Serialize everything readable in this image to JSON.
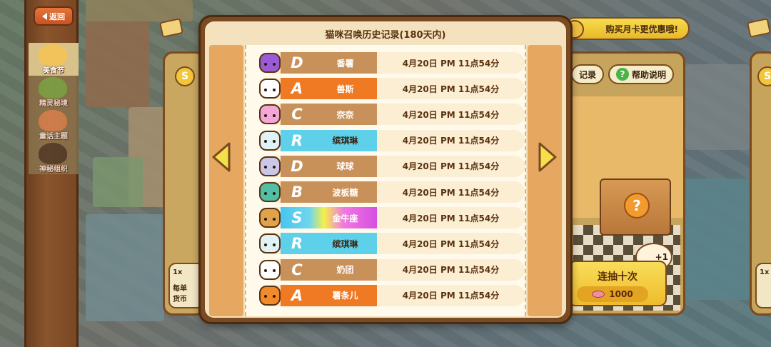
{
  "sidebar": {
    "back_label": "返回",
    "items": [
      {
        "label": "美食节",
        "color": "#f2c35a",
        "active": true
      },
      {
        "label": "精灵秘境",
        "color": "#7ab34c"
      },
      {
        "label": "童话主题",
        "color": "#e58a55"
      },
      {
        "label": "神秘组织",
        "color": "#4a3a2a"
      }
    ]
  },
  "background": {
    "monthly_card": "购买月卡更优惠哦!",
    "record_btn": "记录",
    "help_btn": "帮助说明",
    "help_icon": "?",
    "box_icon": "?",
    "bowl_count": "+1",
    "ten_draw": {
      "label": "连抽十次",
      "cost": "1000"
    },
    "one_draw": {
      "count": "1x",
      "line1": "每单",
      "line2": "货币"
    },
    "one_draw_right": {
      "count": "1x"
    },
    "s_badge": "S"
  },
  "modal": {
    "title": "猫咪召唤历史记录(180天内)",
    "records": [
      {
        "rank": "D",
        "name": "番薯",
        "time": "4月20日 PM 11点54分",
        "cat": "#9a5bd6",
        "style": "plain"
      },
      {
        "rank": "A",
        "name": "兽斯",
        "time": "4月20日 PM 11点54分",
        "cat": "#ffffff",
        "style": "A"
      },
      {
        "rank": "C",
        "name": "奈奈",
        "time": "4月20日 PM 11点54分",
        "cat": "#f3a7d8",
        "style": "plain"
      },
      {
        "rank": "R",
        "name": "缤琪琳",
        "time": "4月20日 PM 11点54分",
        "cat": "#dff2f7",
        "style": "R"
      },
      {
        "rank": "D",
        "name": "球球",
        "time": "4月20日 PM 11点54分",
        "cat": "#cbc7e8",
        "style": "plain"
      },
      {
        "rank": "B",
        "name": "波板糖",
        "time": "4月20日 PM 11点54分",
        "cat": "#4fbfa6",
        "style": "plain"
      },
      {
        "rank": "S",
        "name": "金牛座",
        "time": "4月20日 PM 11点54分",
        "cat": "#e0a24a",
        "style": "S"
      },
      {
        "rank": "R",
        "name": "缤琪琳",
        "time": "4月20日 PM 11点54分",
        "cat": "#dff2f7",
        "style": "R"
      },
      {
        "rank": "C",
        "name": "奶团",
        "time": "4月20日 PM 11点54分",
        "cat": "#ffffff",
        "style": "plain"
      },
      {
        "rank": "A",
        "name": "薯条儿",
        "time": "4月20日 PM 11点54分",
        "cat": "#f28a2a",
        "style": "A"
      }
    ]
  },
  "colors": {
    "plain_bar": "#c9915a",
    "a_bar": "#f07a23",
    "r_bar": "#5ed0ea",
    "s_bar": "linear-gradient(90deg,#49c4ef 0%,#6fd6ee 30%,#f5ef4a 45%,#f07ae0 65%,#d54fe0 100%)",
    "arrow_fill": "#f5e04a",
    "arrow_stroke": "#7a4a20"
  }
}
